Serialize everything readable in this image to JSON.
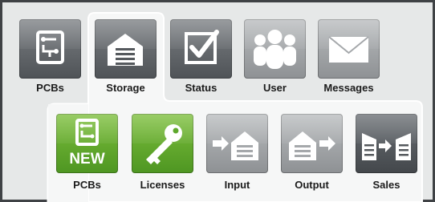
{
  "main_tabs": [
    {
      "label": "PCBs",
      "icon": "pcb-icon",
      "active": false
    },
    {
      "label": "Storage",
      "icon": "warehouse-icon",
      "active": true
    },
    {
      "label": "Status",
      "icon": "checkmark-icon",
      "active": false
    },
    {
      "label": "User",
      "icon": "users-icon",
      "active": false
    },
    {
      "label": "Messages",
      "icon": "envelope-icon",
      "active": false
    }
  ],
  "sub_tabs": [
    {
      "label": "PCBs",
      "icon": "new-pcb-icon",
      "badge": "NEW",
      "highlighted": true
    },
    {
      "label": "Licenses",
      "icon": "key-icon",
      "highlighted": true
    },
    {
      "label": "Input",
      "icon": "warehouse-input-icon",
      "highlighted": false
    },
    {
      "label": "Output",
      "icon": "warehouse-output-icon",
      "highlighted": false
    },
    {
      "label": "Sales",
      "icon": "sales-icon",
      "highlighted": false
    }
  ],
  "colors": {
    "background": "#e6e8e8",
    "frame": "#3f4245",
    "panel": "#ffffff",
    "green": "#5ea82c",
    "icon_dark": "#55595d",
    "icon_light": "#a5a8ab"
  }
}
